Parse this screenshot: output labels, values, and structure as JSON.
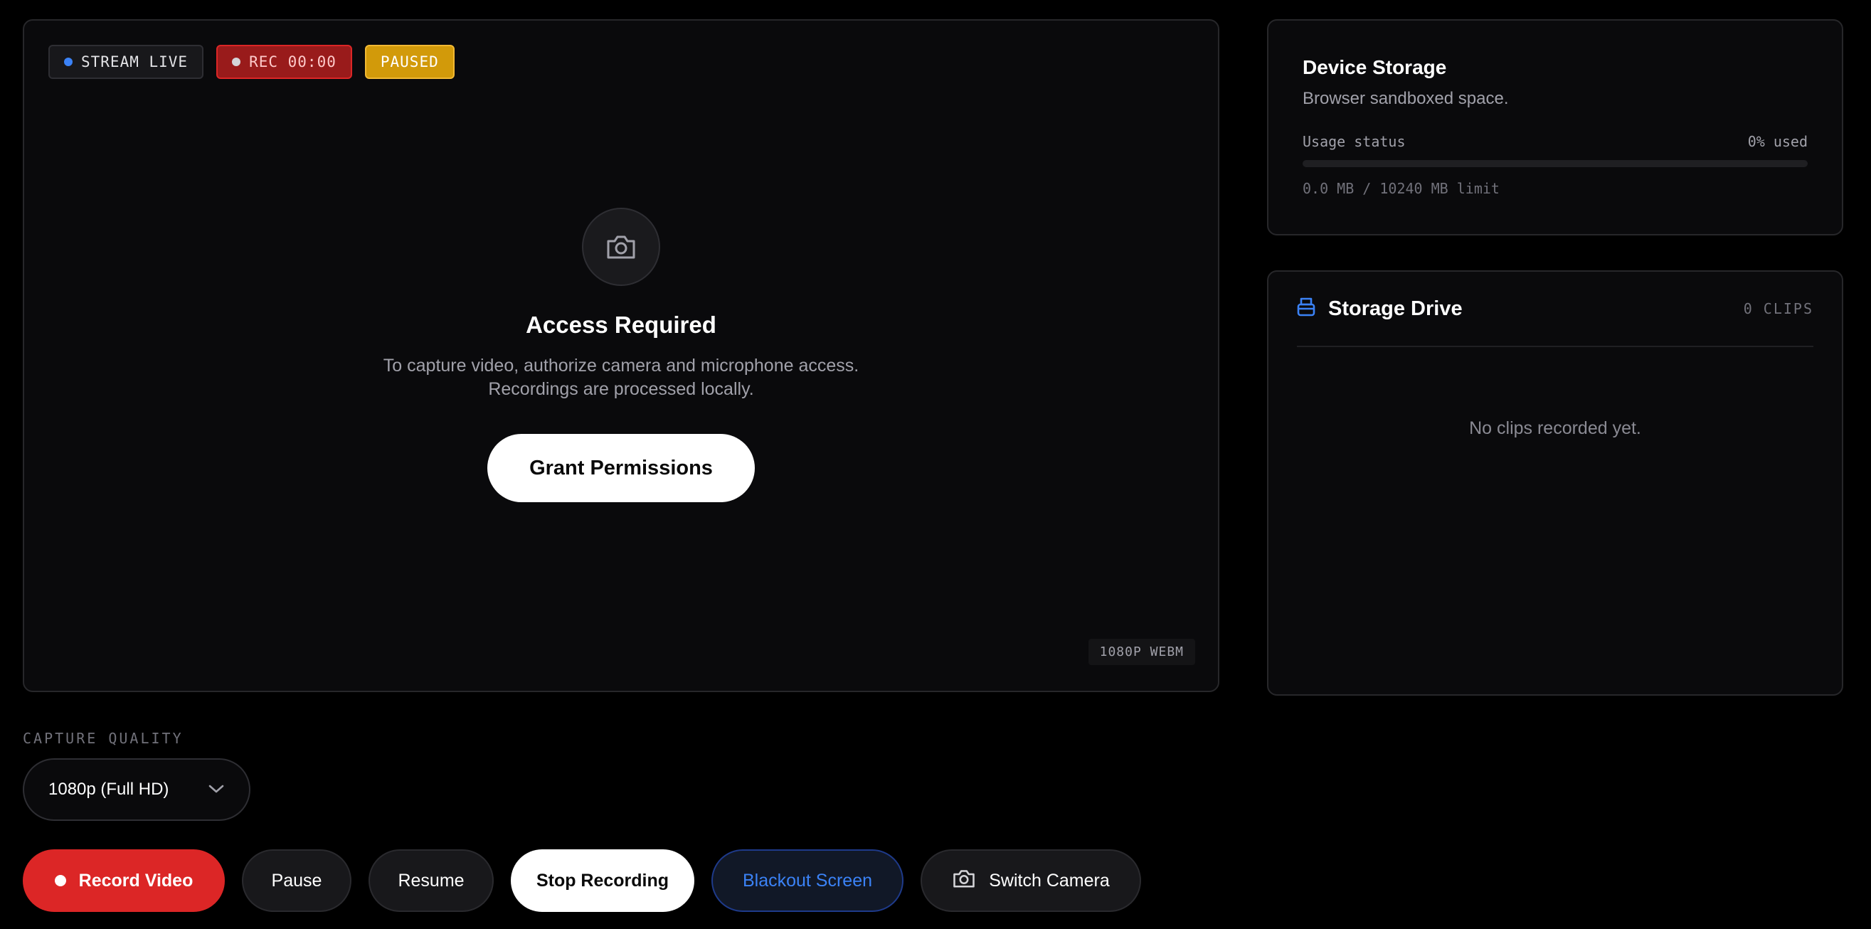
{
  "preview": {
    "badges": {
      "live": "STREAM LIVE",
      "rec": "REC 00:00",
      "paused": "PAUSED"
    },
    "camera_icon": "camera-icon",
    "title": "Access Required",
    "desc_line1": "To capture video, authorize camera and microphone access.",
    "desc_line2": "Recordings are processed locally.",
    "grant_label": "Grant Permissions",
    "format_tag": "1080P WEBM"
  },
  "storage": {
    "title": "Device Storage",
    "subtitle": "Browser sandboxed space.",
    "usage_label": "Usage status",
    "usage_value": "0% used",
    "usage_fraction": 0,
    "limit": "0.0 MB / 10240 MB limit"
  },
  "drive": {
    "icon": "storage-drive-icon",
    "title": "Storage Drive",
    "count": "0 CLIPS",
    "empty": "No clips recorded yet."
  },
  "controls": {
    "quality_label": "CAPTURE QUALITY",
    "quality_value": "1080p (Full HD)",
    "record": "Record Video",
    "pause": "Pause",
    "resume": "Resume",
    "stop": "Stop Recording",
    "blackout": "Blackout Screen",
    "switch": "Switch Camera"
  },
  "colors": {
    "accent_blue": "#3b82f6",
    "record_red": "#dc2626",
    "paused_amber": "#d29a0a"
  }
}
